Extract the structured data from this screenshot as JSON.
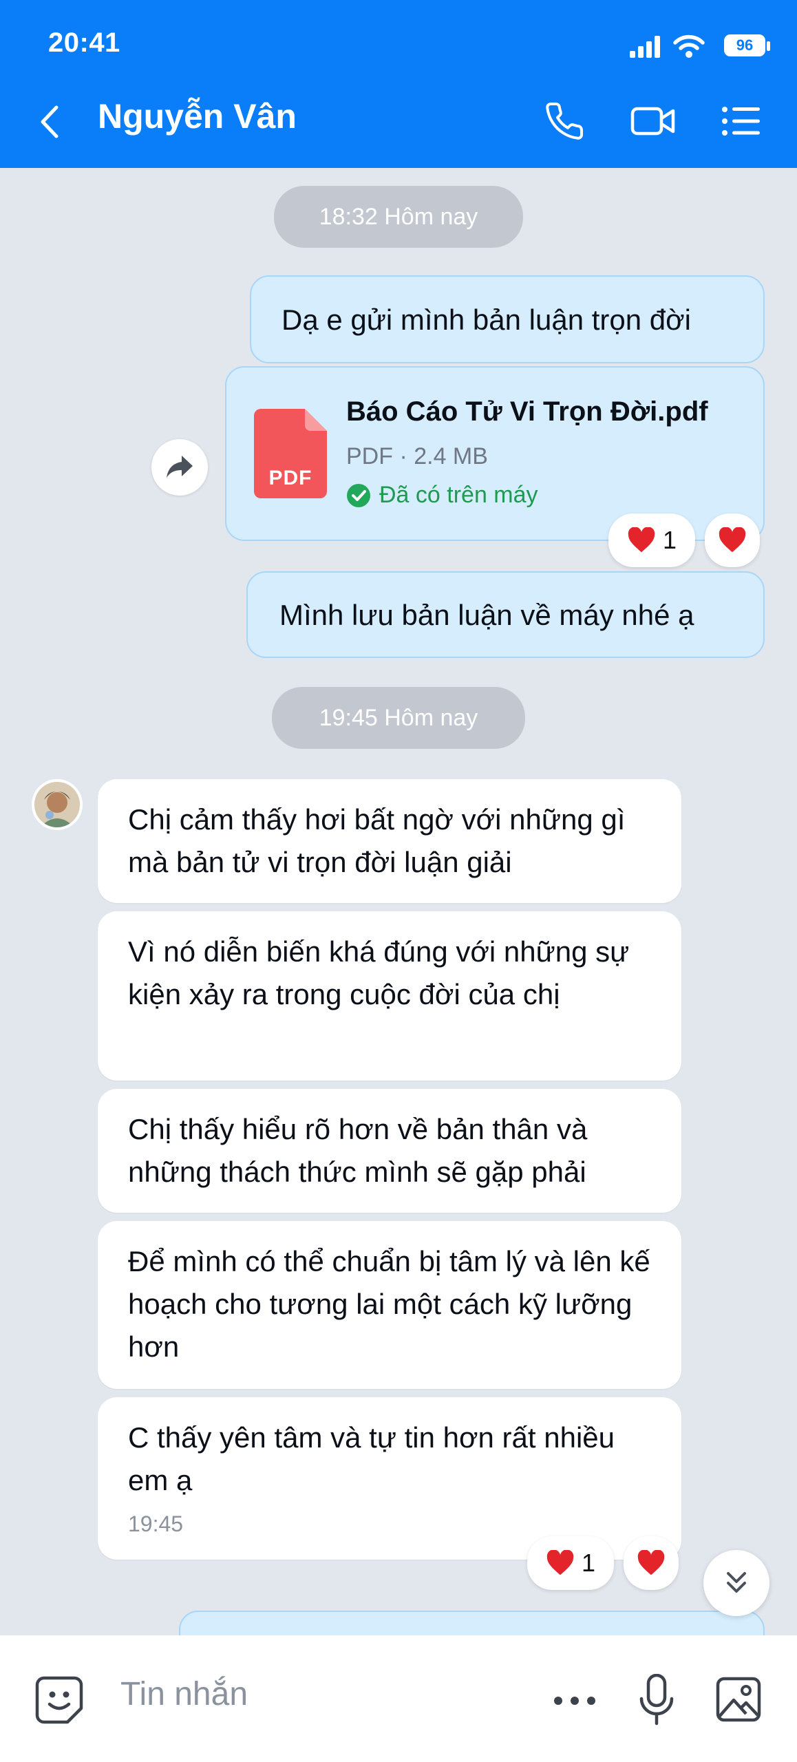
{
  "status_bar": {
    "time": "20:41",
    "battery": "96"
  },
  "header": {
    "title": "Nguyễn Vân"
  },
  "messages": {
    "time_divider_1": "18:32 Hôm nay",
    "out_1": "Dạ e gửi mình bản luận trọn đời",
    "file": {
      "name": "Báo Cáo Tử Vi Trọn Đời.pdf",
      "meta": "PDF · 2.4 MB",
      "status": "Đã có trên máy",
      "icon_label": "PDF"
    },
    "file_reaction_count": "1",
    "out_2": "Mình lưu bản luận về máy nhé ạ",
    "time_divider_2": "19:45 Hôm nay",
    "in_1": "Chị cảm thấy hơi bất ngờ với những gì mà bản tử vi trọn đời luận giải",
    "in_2": "Vì nó diễn biến khá đúng với những sự kiện xảy ra trong cuộc đời của chị",
    "in_3": "Chị thấy hiểu rõ hơn về bản thân và những thách thức mình sẽ gặp phải",
    "in_4": "Để mình có thể chuẩn bị tâm lý và lên kế hoạch cho tương lai một cách kỹ lưỡng hơn",
    "in_5": "C thấy yên tâm và tự tin hơn rất nhiều em ạ",
    "in_5_time": "19:45",
    "in_reaction_count": "1"
  },
  "composer": {
    "placeholder": "Tin nhắn"
  },
  "colors": {
    "accent": "#0a7ef8",
    "outgoing_bubble": "#d5edfd",
    "background": "#e2e7ee",
    "heart": "#e3242b",
    "pdf_icon": "#f2555a",
    "downloaded_check": "#22a85a"
  }
}
